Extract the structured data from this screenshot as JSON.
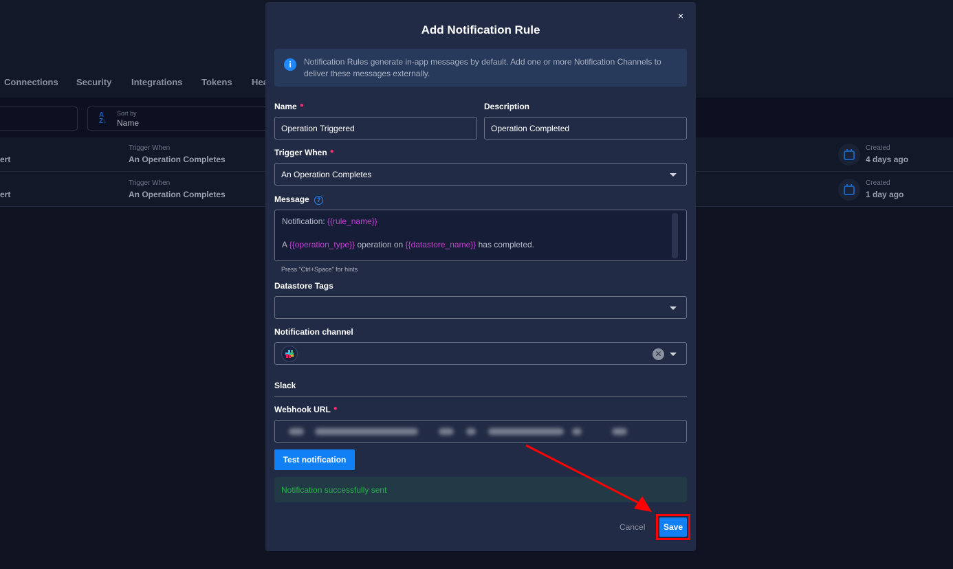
{
  "background": {
    "tabs": [
      "Connections",
      "Security",
      "Integrations",
      "Tokens",
      "Hea"
    ],
    "sort": {
      "label": "Sort by",
      "value": "Name"
    },
    "rows": [
      {
        "name": "ert",
        "trigger_label": "Trigger When",
        "trigger_value": "An Operation Completes",
        "created_label": "Created",
        "created_value": "4 days ago"
      },
      {
        "name": "ert",
        "trigger_label": "Trigger When",
        "trigger_value": "An Operation Completes",
        "created_label": "Created",
        "created_value": "1 day ago"
      }
    ]
  },
  "modal": {
    "title": "Add Notification Rule",
    "close_icon": "×",
    "info": "Notification Rules generate in-app messages by default. Add one or more Notification Channels to deliver these messages externally.",
    "name_label": "Name",
    "name_value": "Operation Triggered",
    "description_label": "Description",
    "description_value": "Operation Completed",
    "trigger_label": "Trigger When",
    "trigger_value": "An Operation Completes",
    "message_label": "Message",
    "message": {
      "line1_prefix": "Notification: ",
      "line1_var": "{{rule_name}}",
      "line2_a": "A ",
      "line2_var1": "{{operation_type}}",
      "line2_b": " operation on ",
      "line2_var2": "{{datastore_name}}",
      "line2_c": " has completed."
    },
    "hint": "Press \"Ctrl+Space\" for hints",
    "tags_label": "Datastore Tags",
    "channel_label": "Notification channel",
    "channel_icon": "slack-icon",
    "section_title": "Slack",
    "webhook_label": "Webhook URL",
    "test_button": "Test notification",
    "success_message": "Notification successfully sent",
    "cancel_button": "Cancel",
    "save_button": "Save"
  },
  "colors": {
    "accent": "#1280f5",
    "required": "#ff2d6a",
    "success": "#29b34b",
    "variable": "#c23fcf",
    "highlight": "#ff0000"
  }
}
